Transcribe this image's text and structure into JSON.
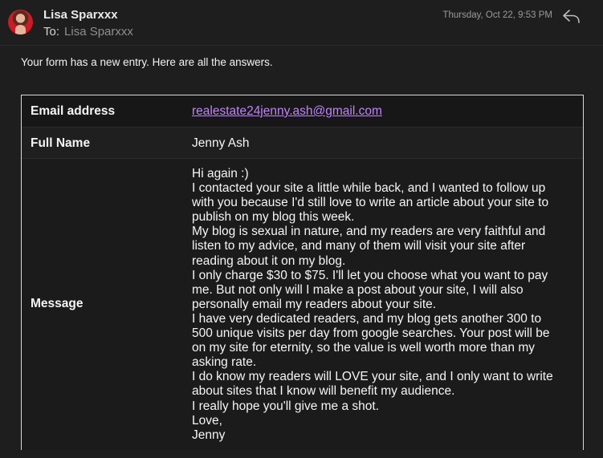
{
  "header": {
    "sender_name": "Lisa Sparxxx",
    "to_label": "To:",
    "to_value": "Lisa Sparxxx",
    "timestamp": "Thursday, Oct 22, 9:53 PM",
    "reply_icon": "reply-arrow-icon",
    "avatar_icon": "avatar-photo"
  },
  "body": {
    "intro": "Your form has a new entry. Here are all the answers."
  },
  "form": {
    "rows": [
      {
        "label": "Email address",
        "value": "realestate24jenny.ash@gmail.com"
      },
      {
        "label": "Full Name",
        "value": "Jenny Ash"
      },
      {
        "label": "Message"
      }
    ],
    "message_lines": [
      "Hi again :)",
      "I contacted your site a little while back, and I wanted to follow up",
      "with you because I'd still love to write an article about your site to",
      "publish on my blog this week.",
      "My blog is sexual in nature, and my readers are very faithful and",
      "listen to my advice, and many of them will visit your site after",
      "reading about it on my blog.",
      "I only charge $30 to $75. I'll let you choose what you want to pay",
      "me. But not only will I make a post about your site, I will also",
      "personally email my readers about your site.",
      "I have very dedicated readers, and my blog gets another 300 to",
      "500 unique visits per day from google searches. Your post will be",
      "on my site for eternity, so the value is well worth more than my",
      "asking rate.",
      "I do know my readers will LOVE your site, and I only want to write",
      "about sites that I know will benefit my audience.",
      "I really hope you'll give me a shot.",
      "Love,",
      "Jenny"
    ]
  },
  "colors": {
    "background": "#1e1e1e",
    "link": "#c084fc",
    "table_border": "#d9d9d9",
    "muted_text": "#8e8e93"
  }
}
